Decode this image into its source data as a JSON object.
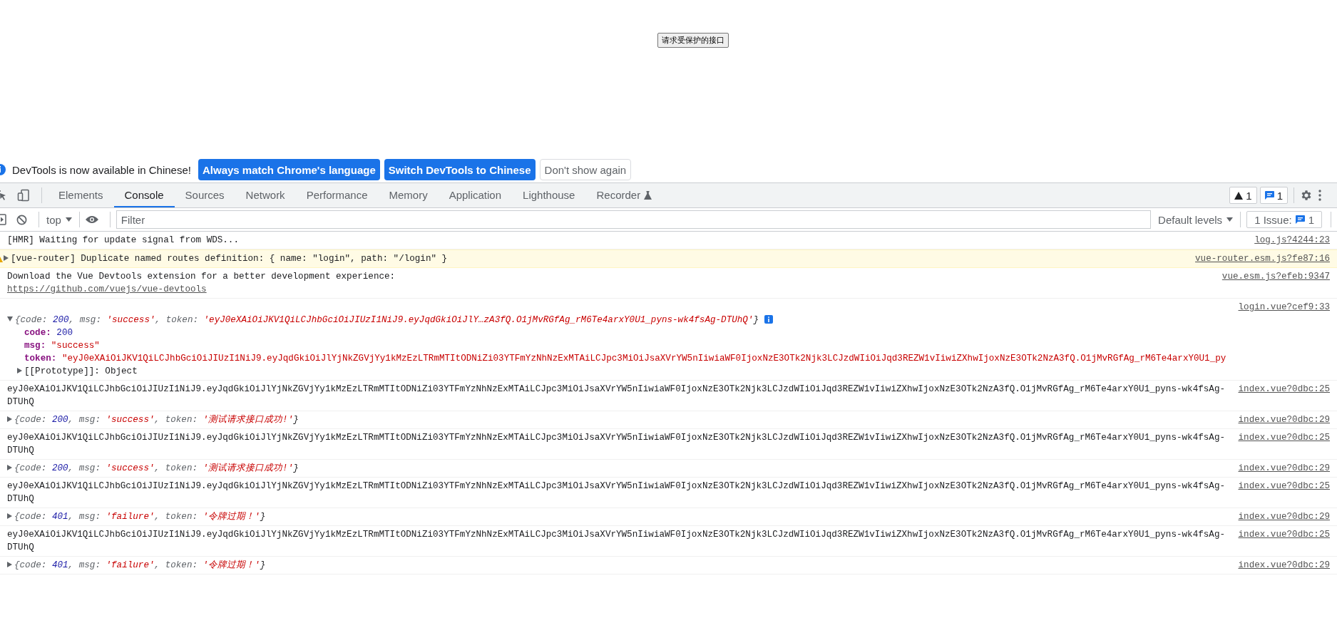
{
  "page": {
    "button": "请求受保护的接口"
  },
  "banner": {
    "message": "DevTools is now available in Chinese!",
    "buttons": [
      {
        "label": "Always match Chrome's language",
        "kind": "primary"
      },
      {
        "label": "Switch DevTools to Chinese",
        "kind": "primary"
      },
      {
        "label": "Don't show again",
        "kind": "secondary"
      }
    ]
  },
  "tabs": [
    {
      "label": "Elements",
      "selected": false
    },
    {
      "label": "Console",
      "selected": true
    },
    {
      "label": "Sources",
      "selected": false
    },
    {
      "label": "Network",
      "selected": false
    },
    {
      "label": "Performance",
      "selected": false
    },
    {
      "label": "Memory",
      "selected": false
    },
    {
      "label": "Application",
      "selected": false
    },
    {
      "label": "Lighthouse",
      "selected": false
    },
    {
      "label": "Recorder",
      "selected": false
    }
  ],
  "counters": {
    "warnings": "1",
    "messages": "1"
  },
  "console_toolbar": {
    "context": "top",
    "filter_placeholder": "Filter",
    "levels": "Default levels",
    "issues_label": "1 Issue:",
    "issues_count": "1"
  },
  "messages": [
    {
      "kind": "log",
      "text": "[HMR] Waiting for update signal from WDS...",
      "source": "log.js?4244:23"
    },
    {
      "kind": "warning",
      "text": "[vue-router] Duplicate named routes definition: { name: \"login\", path: \"/login\" }",
      "source": "vue-router.esm.js?fe87:16"
    },
    {
      "kind": "link-log",
      "text": "Download the Vue Devtools extension for a better development experience:",
      "link": "https://github.com/vuejs/vue-devtools",
      "source": "vue.esm.js?efeb:9347"
    },
    {
      "kind": "object",
      "expanded": true,
      "source": "login.vue?cef9:33",
      "summary": [
        {
          "text": "{code: ",
          "kind": "key"
        },
        {
          "text": "200",
          "kind": "number"
        },
        {
          "text": ", msg: ",
          "kind": "key"
        },
        {
          "text": "'success'",
          "kind": "string"
        },
        {
          "text": ", token: ",
          "kind": "key"
        },
        {
          "text": "'eyJ0eXAiOiJKV1QiLCJhbGciOiJIUzI1NiJ9.eyJqdGkiOiJlY…zA3fQ.O1jMvRGfAg_rM6Te4arxY0U1_pyns-wk4fsAg-DTUhQ'",
          "kind": "string"
        },
        {
          "text": "}",
          "kind": "plain"
        }
      ],
      "properties": [
        {
          "key": "code:",
          "value": "200",
          "kind": "number"
        },
        {
          "key": "msg:",
          "value": "\"success\"",
          "kind": "string"
        },
        {
          "key": "token:",
          "value": "\"eyJ0eXAiOiJKV1QiLCJhbGciOiJIUzI1NiJ9.eyJqdGkiOiJlYjNkZGVjYy1kMzEzLTRmMTItODNiZi03YTFmYzNhNzExMTAiLCJpc3MiOiJsaXVrYW5nIiwiaWF0IjoxNzE3OTk2Njk3LCJzdWIiOiJqd3REZW1vIiwiZXhwIjoxNzE3OTk2NzA3fQ.O1jMvRGfAg_rM6Te4arxY0U1_py",
          "kind": "string"
        }
      ],
      "prototype": "[[Prototype]]: Object"
    },
    {
      "kind": "log",
      "text": "eyJ0eXAiOiJKV1QiLCJhbGciOiJIUzI1NiJ9.eyJqdGkiOiJlYjNkZGVjYy1kMzEzLTRmMTItODNiZi03YTFmYzNhNzExMTAiLCJpc3MiOiJsaXVrYW5nIiwiaWF0IjoxNzE3OTk2Njk3LCJzdWIiOiJqd3REZW1vIiwiZXhwIjoxNzE3OTk2NzA3fQ.O1jMvRGfAg_rM6Te4arxY0U1_pyns-wk4fsAg-DTUhQ",
      "source": "index.vue?0dbc:25"
    },
    {
      "kind": "object",
      "expanded": false,
      "source": "index.vue?0dbc:29",
      "summary": [
        {
          "text": "{code: ",
          "kind": "key"
        },
        {
          "text": "200",
          "kind": "number"
        },
        {
          "text": ", msg: ",
          "kind": "key"
        },
        {
          "text": "'success'",
          "kind": "string"
        },
        {
          "text": ", token: ",
          "kind": "key"
        },
        {
          "text": "'测试请求接口成功!'",
          "kind": "string"
        },
        {
          "text": "}",
          "kind": "plain"
        }
      ]
    },
    {
      "kind": "log",
      "text": "eyJ0eXAiOiJKV1QiLCJhbGciOiJIUzI1NiJ9.eyJqdGkiOiJlYjNkZGVjYy1kMzEzLTRmMTItODNiZi03YTFmYzNhNzExMTAiLCJpc3MiOiJsaXVrYW5nIiwiaWF0IjoxNzE3OTk2Njk3LCJzdWIiOiJqd3REZW1vIiwiZXhwIjoxNzE3OTk2NzA3fQ.O1jMvRGfAg_rM6Te4arxY0U1_pyns-wk4fsAg-DTUhQ",
      "source": "index.vue?0dbc:25"
    },
    {
      "kind": "object",
      "expanded": false,
      "source": "index.vue?0dbc:29",
      "summary": [
        {
          "text": "{code: ",
          "kind": "key"
        },
        {
          "text": "200",
          "kind": "number"
        },
        {
          "text": ", msg: ",
          "kind": "key"
        },
        {
          "text": "'success'",
          "kind": "string"
        },
        {
          "text": ", token: ",
          "kind": "key"
        },
        {
          "text": "'测试请求接口成功!'",
          "kind": "string"
        },
        {
          "text": "}",
          "kind": "plain"
        }
      ]
    },
    {
      "kind": "log",
      "text": "eyJ0eXAiOiJKV1QiLCJhbGciOiJIUzI1NiJ9.eyJqdGkiOiJlYjNkZGVjYy1kMzEzLTRmMTItODNiZi03YTFmYzNhNzExMTAiLCJpc3MiOiJsaXVrYW5nIiwiaWF0IjoxNzE3OTk2Njk3LCJzdWIiOiJqd3REZW1vIiwiZXhwIjoxNzE3OTk2NzA3fQ.O1jMvRGfAg_rM6Te4arxY0U1_pyns-wk4fsAg-DTUhQ",
      "source": "index.vue?0dbc:25"
    },
    {
      "kind": "object",
      "expanded": false,
      "source": "index.vue?0dbc:29",
      "summary": [
        {
          "text": "{code: ",
          "kind": "key"
        },
        {
          "text": "401",
          "kind": "number"
        },
        {
          "text": ", msg: ",
          "kind": "key"
        },
        {
          "text": "'failure'",
          "kind": "string"
        },
        {
          "text": ", token: ",
          "kind": "key"
        },
        {
          "text": "'令牌过期！'",
          "kind": "string"
        },
        {
          "text": "}",
          "kind": "plain"
        }
      ]
    },
    {
      "kind": "log",
      "text": "eyJ0eXAiOiJKV1QiLCJhbGciOiJIUzI1NiJ9.eyJqdGkiOiJlYjNkZGVjYy1kMzEzLTRmMTItODNiZi03YTFmYzNhNzExMTAiLCJpc3MiOiJsaXVrYW5nIiwiaWF0IjoxNzE3OTk2Njk3LCJzdWIiOiJqd3REZW1vIiwiZXhwIjoxNzE3OTk2NzA3fQ.O1jMvRGfAg_rM6Te4arxY0U1_pyns-wk4fsAg-DTUhQ",
      "source": "index.vue?0dbc:25"
    },
    {
      "kind": "object",
      "expanded": false,
      "source": "index.vue?0dbc:29",
      "summary": [
        {
          "text": "{code: ",
          "kind": "key"
        },
        {
          "text": "401",
          "kind": "number"
        },
        {
          "text": ", msg: ",
          "kind": "key"
        },
        {
          "text": "'failure'",
          "kind": "string"
        },
        {
          "text": ", token: ",
          "kind": "key"
        },
        {
          "text": "'令牌过期！'",
          "kind": "string"
        },
        {
          "text": "}",
          "kind": "plain"
        }
      ]
    }
  ]
}
